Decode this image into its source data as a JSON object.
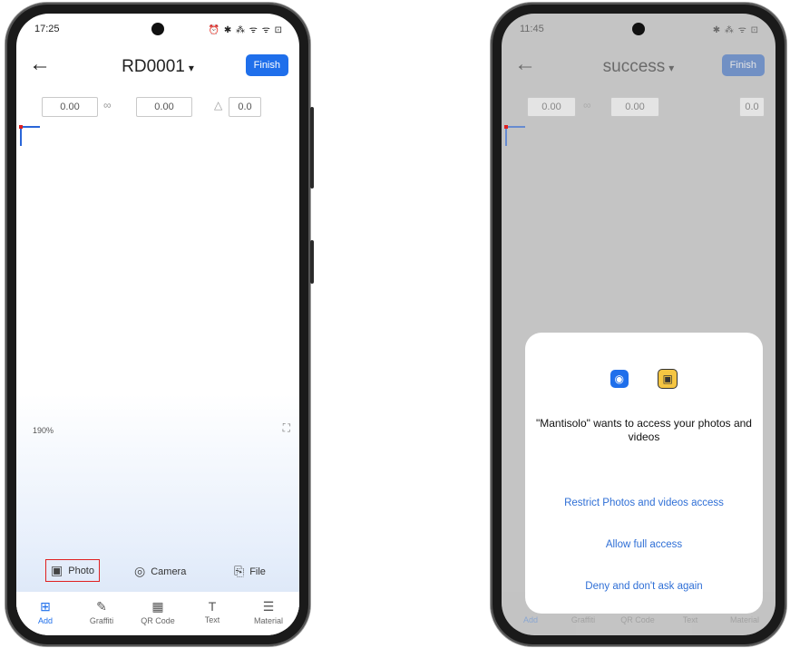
{
  "left_phone": {
    "status": {
      "time": "17:25",
      "icons": "⏰ ✱ ⁂ ᯤ ᯤ ⊡"
    },
    "header": {
      "back_icon": "←",
      "title": "RD0001",
      "title_caret": "▾",
      "finish_label": "Finish"
    },
    "dimensions": {
      "width": "0.00",
      "link_icon": "∞",
      "height": "0.00",
      "angle_icon": "△",
      "rotation": "0.0"
    },
    "canvas": {
      "zoom": "190%",
      "fit_icon": "⛶"
    },
    "add_options": [
      {
        "label": "Photo",
        "icon": "▣"
      },
      {
        "label": "Camera",
        "icon": "◎"
      },
      {
        "label": "File",
        "icon": "⎘"
      }
    ],
    "tabs": [
      {
        "label": "Add",
        "icon": "⊞"
      },
      {
        "label": "Graffiti",
        "icon": "✎"
      },
      {
        "label": "QR Code",
        "icon": "▦"
      },
      {
        "label": "Text",
        "icon": "T"
      },
      {
        "label": "Material",
        "icon": "☰"
      }
    ]
  },
  "right_phone": {
    "status": {
      "time": "11:45",
      "icons": "✱ ⁂ ᯤ ⊡"
    },
    "header": {
      "back_icon": "←",
      "title": "success",
      "title_caret": "▾",
      "finish_label": "Finish"
    },
    "dimensions": {
      "width": "0.00",
      "link_icon": "∞",
      "height": "0.00",
      "rotation": "0.0"
    },
    "dialog": {
      "app_icon": "◉",
      "gallery_icon": "▣",
      "message": "\"Mantisolo\" wants to access your photos and videos",
      "options": [
        "Restrict Photos and videos access",
        "Allow full access",
        "Deny and don't ask again"
      ]
    },
    "tabs": [
      {
        "label": "Add"
      },
      {
        "label": "Graffiti"
      },
      {
        "label": "QR Code"
      },
      {
        "label": "Text"
      },
      {
        "label": "Material"
      }
    ]
  },
  "colors": {
    "accent": "#1f6feb",
    "highlight": "#e02020",
    "dialog_link": "#2f6fd6"
  }
}
